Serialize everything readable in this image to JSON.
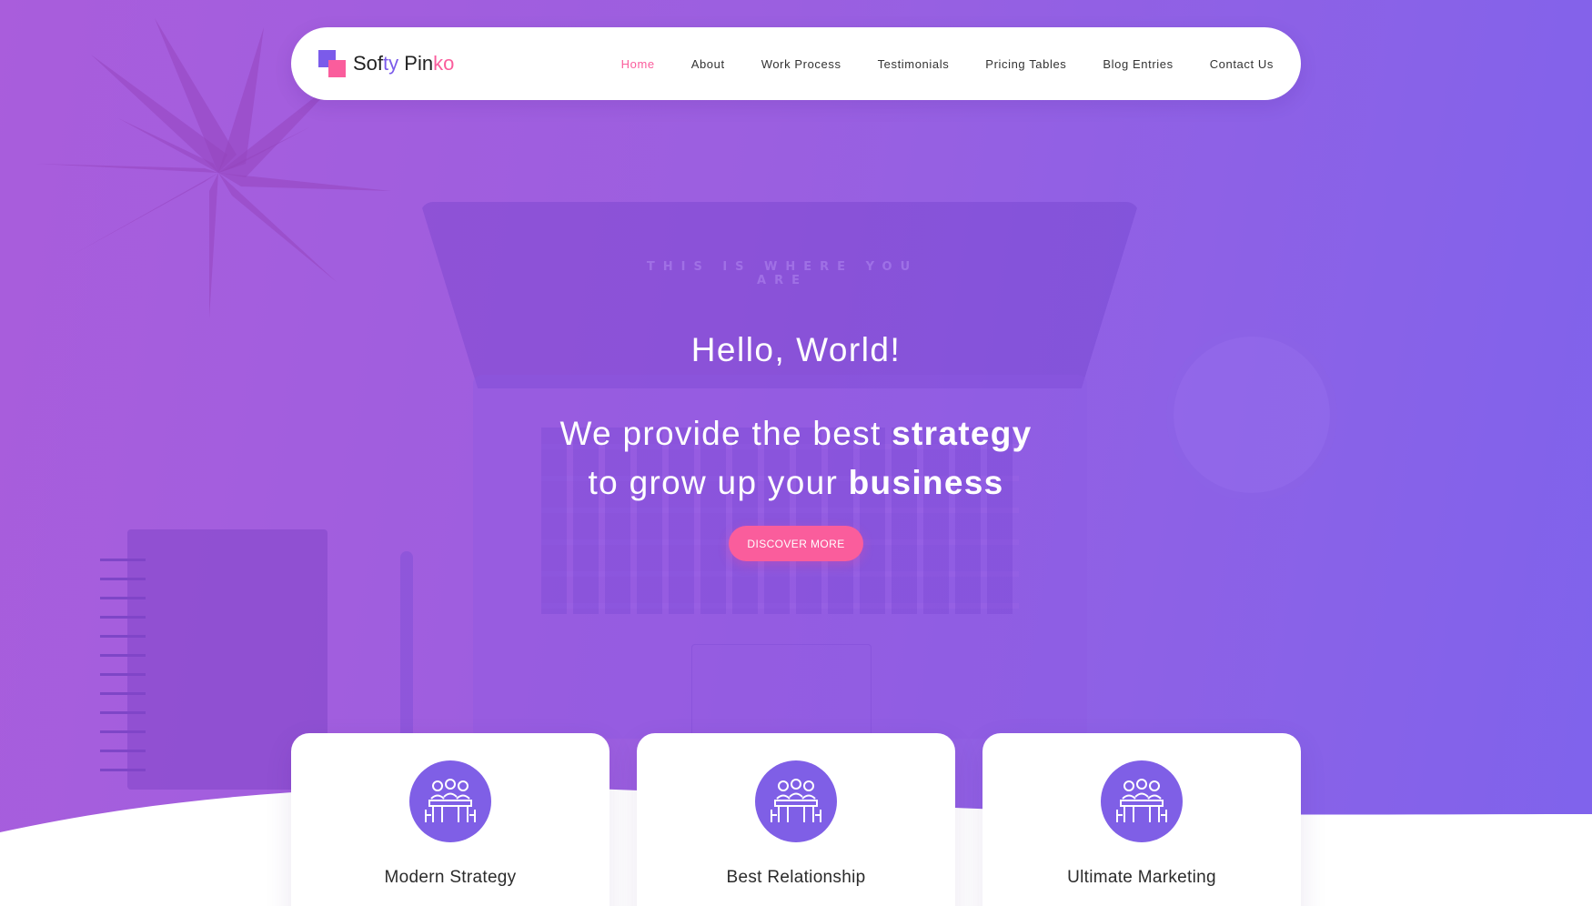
{
  "brand": {
    "name_parts": [
      "Sof",
      "ty",
      " Pin",
      "ko"
    ],
    "colors": {
      "purple": "#7b5bea",
      "pink": "#fa5d9c"
    }
  },
  "nav": {
    "items": [
      {
        "label": "Home",
        "active": true
      },
      {
        "label": "About",
        "active": false
      },
      {
        "label": "Work Process",
        "active": false
      },
      {
        "label": "Testimonials",
        "active": false
      },
      {
        "label": "Pricing Tables",
        "active": false
      },
      {
        "label": "Blog Entries",
        "active": false
      },
      {
        "label": "Contact Us",
        "active": false
      }
    ]
  },
  "hero": {
    "greeting": "Hello, World!",
    "line1_prefix": "We provide the best ",
    "line1_bold": "strategy",
    "line2_prefix": "to grow up your ",
    "line2_bold": "business",
    "cta_label": "DISCOVER MORE",
    "screen_text": "THIS IS WHERE YOU ARE"
  },
  "features": [
    {
      "title": "Modern Strategy",
      "icon": "team-meeting-icon"
    },
    {
      "title": "Best Relationship",
      "icon": "team-meeting-icon"
    },
    {
      "title": "Ultimate Marketing",
      "icon": "team-meeting-icon"
    }
  ]
}
